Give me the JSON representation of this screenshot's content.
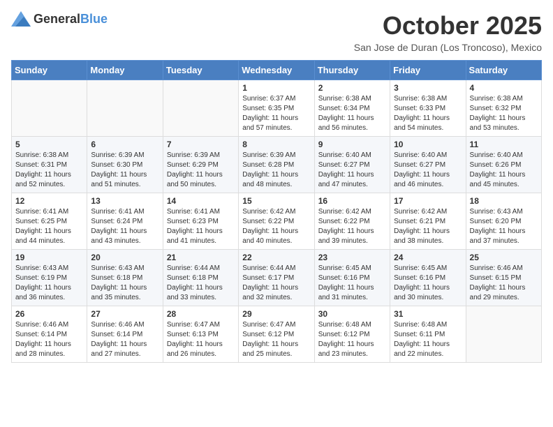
{
  "header": {
    "logo": {
      "general": "General",
      "blue": "Blue"
    },
    "month": "October 2025",
    "location": "San Jose de Duran (Los Troncoso), Mexico"
  },
  "weekdays": [
    "Sunday",
    "Monday",
    "Tuesday",
    "Wednesday",
    "Thursday",
    "Friday",
    "Saturday"
  ],
  "weeks": [
    [
      {
        "day": "",
        "sunrise": "",
        "sunset": "",
        "daylight": ""
      },
      {
        "day": "",
        "sunrise": "",
        "sunset": "",
        "daylight": ""
      },
      {
        "day": "",
        "sunrise": "",
        "sunset": "",
        "daylight": ""
      },
      {
        "day": "1",
        "sunrise": "Sunrise: 6:37 AM",
        "sunset": "Sunset: 6:35 PM",
        "daylight": "Daylight: 11 hours and 57 minutes."
      },
      {
        "day": "2",
        "sunrise": "Sunrise: 6:38 AM",
        "sunset": "Sunset: 6:34 PM",
        "daylight": "Daylight: 11 hours and 56 minutes."
      },
      {
        "day": "3",
        "sunrise": "Sunrise: 6:38 AM",
        "sunset": "Sunset: 6:33 PM",
        "daylight": "Daylight: 11 hours and 54 minutes."
      },
      {
        "day": "4",
        "sunrise": "Sunrise: 6:38 AM",
        "sunset": "Sunset: 6:32 PM",
        "daylight": "Daylight: 11 hours and 53 minutes."
      }
    ],
    [
      {
        "day": "5",
        "sunrise": "Sunrise: 6:38 AM",
        "sunset": "Sunset: 6:31 PM",
        "daylight": "Daylight: 11 hours and 52 minutes."
      },
      {
        "day": "6",
        "sunrise": "Sunrise: 6:39 AM",
        "sunset": "Sunset: 6:30 PM",
        "daylight": "Daylight: 11 hours and 51 minutes."
      },
      {
        "day": "7",
        "sunrise": "Sunrise: 6:39 AM",
        "sunset": "Sunset: 6:29 PM",
        "daylight": "Daylight: 11 hours and 50 minutes."
      },
      {
        "day": "8",
        "sunrise": "Sunrise: 6:39 AM",
        "sunset": "Sunset: 6:28 PM",
        "daylight": "Daylight: 11 hours and 48 minutes."
      },
      {
        "day": "9",
        "sunrise": "Sunrise: 6:40 AM",
        "sunset": "Sunset: 6:27 PM",
        "daylight": "Daylight: 11 hours and 47 minutes."
      },
      {
        "day": "10",
        "sunrise": "Sunrise: 6:40 AM",
        "sunset": "Sunset: 6:27 PM",
        "daylight": "Daylight: 11 hours and 46 minutes."
      },
      {
        "day": "11",
        "sunrise": "Sunrise: 6:40 AM",
        "sunset": "Sunset: 6:26 PM",
        "daylight": "Daylight: 11 hours and 45 minutes."
      }
    ],
    [
      {
        "day": "12",
        "sunrise": "Sunrise: 6:41 AM",
        "sunset": "Sunset: 6:25 PM",
        "daylight": "Daylight: 11 hours and 44 minutes."
      },
      {
        "day": "13",
        "sunrise": "Sunrise: 6:41 AM",
        "sunset": "Sunset: 6:24 PM",
        "daylight": "Daylight: 11 hours and 43 minutes."
      },
      {
        "day": "14",
        "sunrise": "Sunrise: 6:41 AM",
        "sunset": "Sunset: 6:23 PM",
        "daylight": "Daylight: 11 hours and 41 minutes."
      },
      {
        "day": "15",
        "sunrise": "Sunrise: 6:42 AM",
        "sunset": "Sunset: 6:22 PM",
        "daylight": "Daylight: 11 hours and 40 minutes."
      },
      {
        "day": "16",
        "sunrise": "Sunrise: 6:42 AM",
        "sunset": "Sunset: 6:22 PM",
        "daylight": "Daylight: 11 hours and 39 minutes."
      },
      {
        "day": "17",
        "sunrise": "Sunrise: 6:42 AM",
        "sunset": "Sunset: 6:21 PM",
        "daylight": "Daylight: 11 hours and 38 minutes."
      },
      {
        "day": "18",
        "sunrise": "Sunrise: 6:43 AM",
        "sunset": "Sunset: 6:20 PM",
        "daylight": "Daylight: 11 hours and 37 minutes."
      }
    ],
    [
      {
        "day": "19",
        "sunrise": "Sunrise: 6:43 AM",
        "sunset": "Sunset: 6:19 PM",
        "daylight": "Daylight: 11 hours and 36 minutes."
      },
      {
        "day": "20",
        "sunrise": "Sunrise: 6:43 AM",
        "sunset": "Sunset: 6:18 PM",
        "daylight": "Daylight: 11 hours and 35 minutes."
      },
      {
        "day": "21",
        "sunrise": "Sunrise: 6:44 AM",
        "sunset": "Sunset: 6:18 PM",
        "daylight": "Daylight: 11 hours and 33 minutes."
      },
      {
        "day": "22",
        "sunrise": "Sunrise: 6:44 AM",
        "sunset": "Sunset: 6:17 PM",
        "daylight": "Daylight: 11 hours and 32 minutes."
      },
      {
        "day": "23",
        "sunrise": "Sunrise: 6:45 AM",
        "sunset": "Sunset: 6:16 PM",
        "daylight": "Daylight: 11 hours and 31 minutes."
      },
      {
        "day": "24",
        "sunrise": "Sunrise: 6:45 AM",
        "sunset": "Sunset: 6:16 PM",
        "daylight": "Daylight: 11 hours and 30 minutes."
      },
      {
        "day": "25",
        "sunrise": "Sunrise: 6:46 AM",
        "sunset": "Sunset: 6:15 PM",
        "daylight": "Daylight: 11 hours and 29 minutes."
      }
    ],
    [
      {
        "day": "26",
        "sunrise": "Sunrise: 6:46 AM",
        "sunset": "Sunset: 6:14 PM",
        "daylight": "Daylight: 11 hours and 28 minutes."
      },
      {
        "day": "27",
        "sunrise": "Sunrise: 6:46 AM",
        "sunset": "Sunset: 6:14 PM",
        "daylight": "Daylight: 11 hours and 27 minutes."
      },
      {
        "day": "28",
        "sunrise": "Sunrise: 6:47 AM",
        "sunset": "Sunset: 6:13 PM",
        "daylight": "Daylight: 11 hours and 26 minutes."
      },
      {
        "day": "29",
        "sunrise": "Sunrise: 6:47 AM",
        "sunset": "Sunset: 6:12 PM",
        "daylight": "Daylight: 11 hours and 25 minutes."
      },
      {
        "day": "30",
        "sunrise": "Sunrise: 6:48 AM",
        "sunset": "Sunset: 6:12 PM",
        "daylight": "Daylight: 11 hours and 23 minutes."
      },
      {
        "day": "31",
        "sunrise": "Sunrise: 6:48 AM",
        "sunset": "Sunset: 6:11 PM",
        "daylight": "Daylight: 11 hours and 22 minutes."
      },
      {
        "day": "",
        "sunrise": "",
        "sunset": "",
        "daylight": ""
      }
    ]
  ]
}
